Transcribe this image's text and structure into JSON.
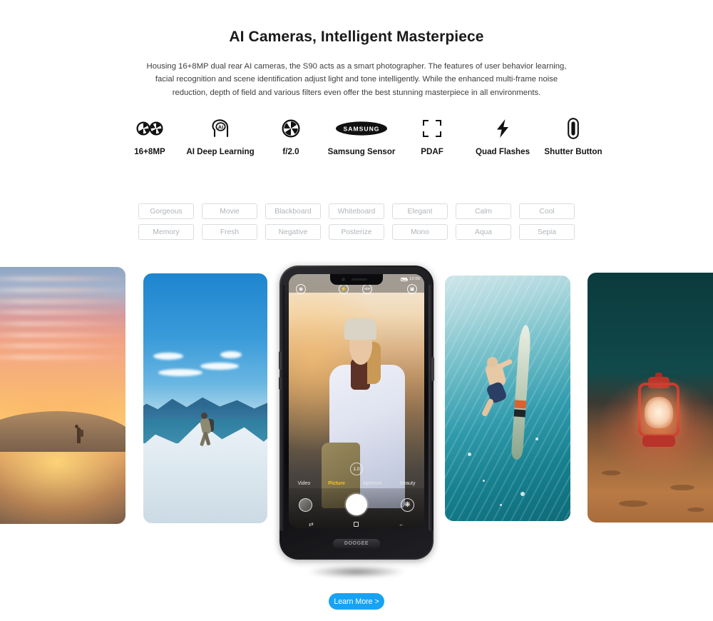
{
  "header": {
    "title": "AI Cameras, Intelligent Masterpiece",
    "description": "Housing 16+8MP dual rear AI cameras, the S90 acts as a smart photographer. The features of user behavior learning, facial recognition and scene identification adjust light and tone intelligently. While the enhanced multi-frame noise reduction, depth of field and various filters even offer the best stunning masterpiece in all environments."
  },
  "features": [
    {
      "icon": "dual-aperture-icon",
      "label": "16+8MP"
    },
    {
      "icon": "ai-head-icon",
      "label": "AI Deep Learning"
    },
    {
      "icon": "aperture-icon",
      "label": "f/2.0"
    },
    {
      "icon": "samsung-logo-icon",
      "label": "Samsung Sensor"
    },
    {
      "icon": "focus-brackets-icon",
      "label": "PDAF"
    },
    {
      "icon": "lightning-bolt-icon",
      "label": "Quad Flashes"
    },
    {
      "icon": "shutter-button-icon",
      "label": "Shutter Button"
    }
  ],
  "filters": [
    "Gorgeous",
    "Movie",
    "Blackboard",
    "Whiteboard",
    "Elegant",
    "Calm",
    "Cool",
    "Memory",
    "Fresh",
    "Negative",
    "Posterize",
    "Mono",
    "Aqua",
    "Sepia"
  ],
  "gallery": [
    {
      "name": "desert-sunset-photo",
      "caption": "Desert sunset with lone hiker silhouette"
    },
    {
      "name": "mountain-hiker-photo",
      "caption": "Hiker on snowy mountain ridge"
    },
    {
      "name": "underwater-surfer-photo",
      "caption": "Surfer diving underwater with board"
    },
    {
      "name": "red-lantern-photo",
      "caption": "Glowing red lantern on night sand"
    }
  ],
  "phone": {
    "brand": "DOOGEE",
    "status": {
      "time": "12:00"
    },
    "top_icons": [
      "settings-icon",
      "flash-icon",
      "HDR",
      "switch-camera-icon"
    ],
    "hdr_label": "HDR",
    "zoom_level": "1.0",
    "modes": [
      "Video",
      "Picture",
      "Aperture",
      "Beauty"
    ],
    "active_mode": "Picture",
    "viewfinder_caption": "Woman hiker in white jacket at golden hour"
  },
  "cta": {
    "label": "Learn More >"
  },
  "colors": {
    "accent": "#17a3f2",
    "mode_active": "#f5c21c",
    "chip_border": "#d9dde0",
    "chip_text": "#b0b5b9",
    "title": "#1a1a1a"
  }
}
